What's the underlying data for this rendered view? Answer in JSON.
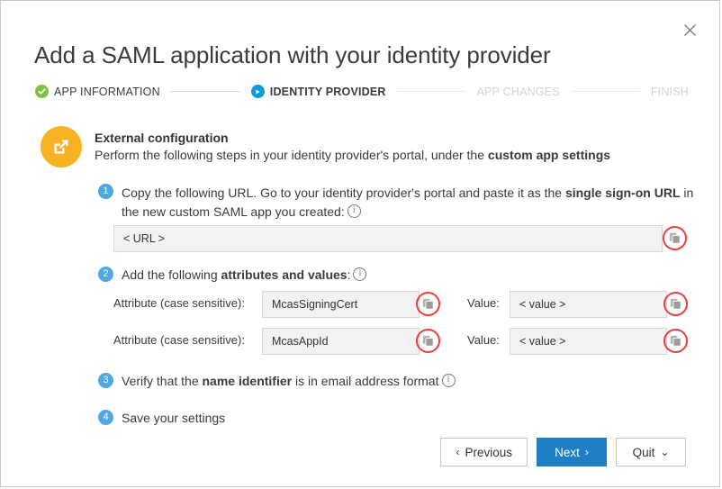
{
  "dialog": {
    "title": "Add a SAML application with your identity provider",
    "close_icon": "close-icon"
  },
  "stepper": {
    "steps": [
      {
        "label": "APP INFORMATION",
        "state": "done",
        "marker": "check-icon"
      },
      {
        "label": "IDENTITY PROVIDER",
        "state": "current",
        "marker": "play-icon"
      },
      {
        "label": "APP CHANGES",
        "state": "upcoming",
        "marker": ""
      },
      {
        "label": "FINISH",
        "state": "upcoming",
        "marker": ""
      }
    ]
  },
  "external_config": {
    "icon": "external-link-icon",
    "title": "External configuration",
    "subtitle_prefix": "Perform the following steps in your identity provider's portal, under the ",
    "subtitle_bold": "custom app settings"
  },
  "steps": {
    "one": {
      "number": "1",
      "text_a": "Copy the following URL. Go to your identity provider's portal and paste it as the ",
      "text_bold": "single sign-on URL",
      "text_b": " in the new custom SAML app you created:",
      "info_icon": "info-icon",
      "url_field_value": "< URL >",
      "url_field_placeholder": "< URL >",
      "copy_icon": "copy-icon"
    },
    "two": {
      "number": "2",
      "text_a": "Add the following ",
      "text_bold": "attributes and values",
      "text_b": ":",
      "info_icon": "info-icon",
      "rows": [
        {
          "attribute_label": "Attribute (case sensitive):",
          "attribute_value": "McasSigningCert",
          "value_label": "Value:",
          "value_value": "< value >",
          "copy_icon": "copy-icon"
        },
        {
          "attribute_label": "Attribute (case sensitive):",
          "attribute_value": "McasAppId",
          "value_label": "Value:",
          "value_value": "< value >",
          "copy_icon": "copy-icon"
        }
      ]
    },
    "three": {
      "number": "3",
      "text_a": "Verify that the ",
      "text_bold": "name identifier",
      "text_b": " is in email address format",
      "info_icon": "info-icon"
    },
    "four": {
      "number": "4",
      "text": "Save your settings"
    }
  },
  "footer": {
    "previous_label": "Previous",
    "previous_chevron": "‹",
    "next_label": "Next",
    "next_chevron": "›",
    "quit_label": "Quit",
    "quit_chevron": "⌄"
  },
  "colors": {
    "accent_blue": "#1e7fc4",
    "step_blue": "#0f9bd7",
    "number_blue": "#4fa8e0",
    "done_green": "#7cc144",
    "orange": "#f7b323",
    "highlight_red": "#ef3b3b"
  }
}
